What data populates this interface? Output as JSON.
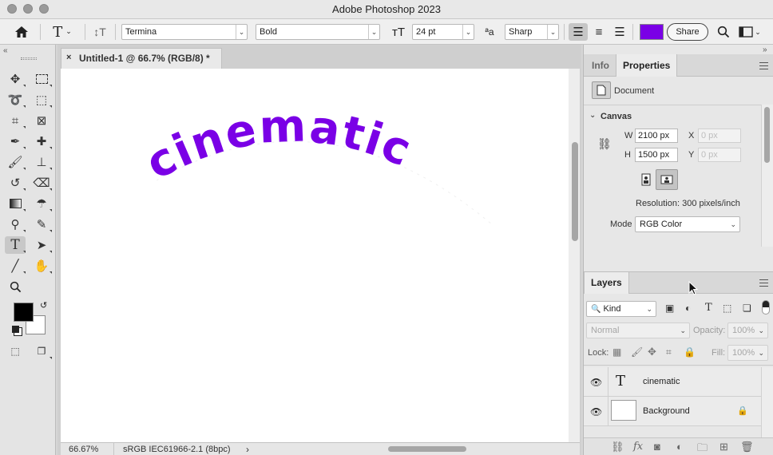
{
  "window": {
    "title": "Adobe Photoshop 2023"
  },
  "optionsBar": {
    "font_family": "Termina",
    "font_style": "Bold",
    "font_size": "24 pt",
    "antialias": "Sharp",
    "text_color": "#7a00e6",
    "share_label": "Share"
  },
  "document": {
    "tab_label": "Untitled-1 @ 66.7% (RGB/8) *",
    "canvas_text": "cinematic",
    "text_color": "#7a00e6",
    "zoom": "66.67%",
    "color_profile": "sRGB IEC61966-2.1 (8bpc)"
  },
  "properties": {
    "tabs": [
      "Info",
      "Properties"
    ],
    "section_label": "Document",
    "canvas_title": "Canvas",
    "w_label": "W",
    "w_value": "2100 px",
    "h_label": "H",
    "h_value": "1500 px",
    "x_label": "X",
    "x_placeholder": "0 px",
    "y_label": "Y",
    "y_placeholder": "0 px",
    "resolution": "Resolution: 300 pixels/inch",
    "mode_label": "Mode",
    "mode_value": "RGB Color"
  },
  "layers": {
    "tab_label": "Layers",
    "kind_filter": "Kind",
    "blend_mode": "Normal",
    "opacity_label": "Opacity:",
    "opacity_value": "100%",
    "lock_label": "Lock:",
    "fill_label": "Fill:",
    "fill_value": "100%",
    "items": [
      {
        "name": "cinematic",
        "type": "text"
      },
      {
        "name": "Background",
        "type": "image",
        "locked": true
      }
    ]
  },
  "toolbar": {
    "foreground_color": "#000000",
    "background_color": "#ffffff"
  }
}
